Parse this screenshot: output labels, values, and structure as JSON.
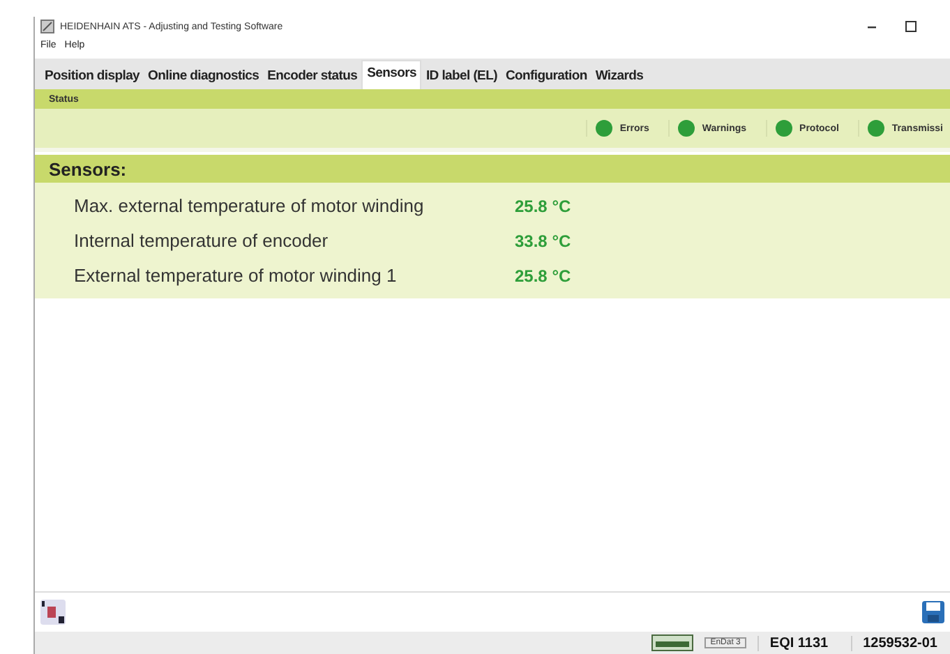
{
  "window": {
    "title": "HEIDENHAIN ATS - Adjusting and Testing Software"
  },
  "menu": [
    "File",
    "Help"
  ],
  "tabs": [
    {
      "label": "Position display",
      "selected": false
    },
    {
      "label": "Online diagnostics",
      "selected": false
    },
    {
      "label": "Encoder status",
      "selected": false
    },
    {
      "label": "Sensors",
      "selected": true
    },
    {
      "label": "ID label (EL)",
      "selected": false
    },
    {
      "label": "Configuration",
      "selected": false
    },
    {
      "label": "Wizards",
      "selected": false
    }
  ],
  "status": {
    "title": "Status",
    "indicators": [
      {
        "label": "Errors",
        "color": "#2e9e3a"
      },
      {
        "label": "Warnings",
        "color": "#2e9e3a"
      },
      {
        "label": "Protocol",
        "color": "#2e9e3a"
      },
      {
        "label": "Transmissi",
        "color": "#2e9e3a"
      }
    ]
  },
  "sensors": {
    "title": "Sensors:",
    "rows": [
      {
        "name": "Max. external temperature of motor winding",
        "value": "25.8 °C"
      },
      {
        "name": "Internal temperature of encoder",
        "value": "33.8 °C"
      },
      {
        "name": "External temperature of motor winding 1",
        "value": "25.8 °C"
      }
    ]
  },
  "status_bar": {
    "interface": "EnDat 3",
    "device": "EQI 1131",
    "id": "1259532-01"
  }
}
